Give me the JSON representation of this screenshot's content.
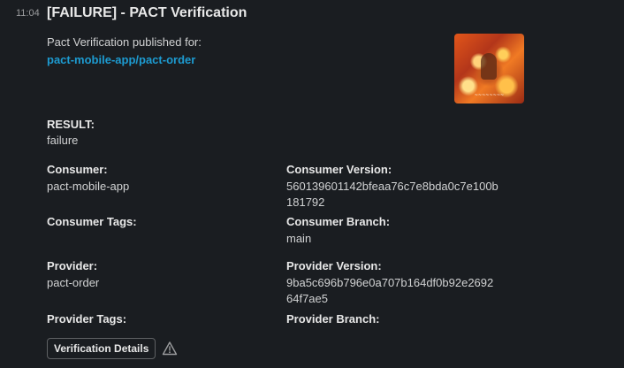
{
  "message": {
    "time": "11:04",
    "title": "[FAILURE] - PACT Verification",
    "intro": "Pact Verification published for:",
    "link_text": "pact-mobile-app/pact-order",
    "image_caption": "~~~~~~~~"
  },
  "fields": {
    "result_label": "RESULT:",
    "result_value": "failure",
    "consumer_label": "Consumer:",
    "consumer_value": "pact-mobile-app",
    "consumer_version_label": "Consumer Version:",
    "consumer_version_line1": "560139601142bfeaa76c7e8bda0c7e100b",
    "consumer_version_line2": "181792",
    "consumer_tags_label": "Consumer Tags:",
    "consumer_branch_label": "Consumer Branch:",
    "consumer_branch_value": "main",
    "provider_label": "Provider:",
    "provider_value": "pact-order",
    "provider_version_label": "Provider Version:",
    "provider_version_line1": "9ba5c696b796e0a707b164df0b92e2692",
    "provider_version_line2": "64f7ae5",
    "provider_tags_label": "Provider Tags:",
    "provider_branch_label": "Provider Branch:"
  },
  "actions": {
    "details_button": "Verification Details",
    "warning_icon": "warning-triangle-icon"
  },
  "colors": {
    "background": "#1a1d21",
    "link": "#1d9bd1",
    "text": "#d1d2d3"
  }
}
